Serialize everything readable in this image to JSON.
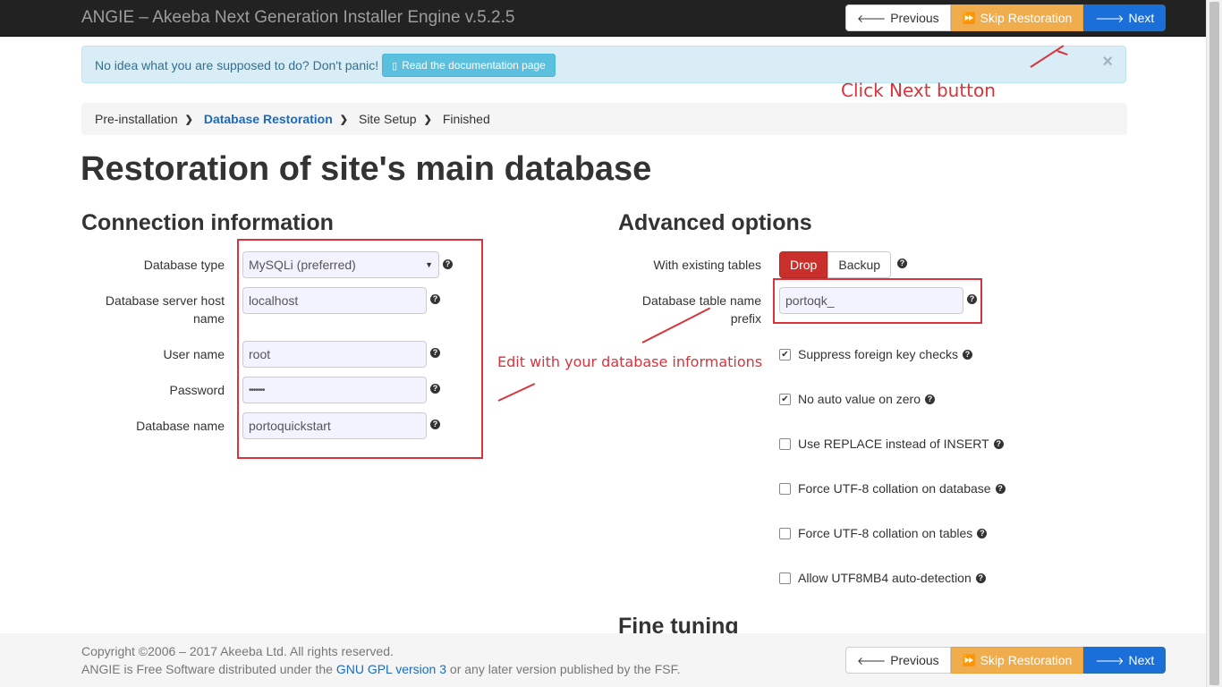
{
  "navbar": {
    "brand": "ANGIE – Akeeba Next Generation Installer Engine v.5.2.5",
    "previous": "Previous",
    "skip": "Skip Restoration",
    "next": "Next"
  },
  "alert": {
    "text": "No idea what you are supposed to do? Don't panic!",
    "doc_button": "Read the documentation page",
    "close": "×"
  },
  "breadcrumb": {
    "items": [
      "Pre-installation",
      "Database Restoration",
      "Site Setup",
      "Finished"
    ]
  },
  "page_title": "Restoration of site's main database",
  "connection": {
    "heading": "Connection information",
    "db_type_label": "Database type",
    "db_type_value": "MySQLi (preferred)",
    "host_label_1": "Database server host",
    "host_label_2": "name",
    "host_value": "localhost",
    "user_label": "User name",
    "user_value": "root",
    "password_label": "Password",
    "password_value": "•••••••",
    "dbname_label": "Database name",
    "dbname_value": "portoquickstart"
  },
  "advanced": {
    "heading": "Advanced options",
    "existing_label": "With existing tables",
    "drop": "Drop",
    "backup": "Backup",
    "prefix_label_1": "Database table name",
    "prefix_label_2": "prefix",
    "prefix_value": "portoqk_",
    "checkboxes": [
      {
        "label": "Suppress foreign key checks",
        "checked": true
      },
      {
        "label": "No auto value on zero",
        "checked": true
      },
      {
        "label": "Use REPLACE instead of INSERT",
        "checked": false
      },
      {
        "label": "Force UTF-8 collation on database",
        "checked": false
      },
      {
        "label": "Force UTF-8 collation on tables",
        "checked": false
      },
      {
        "label": "Allow UTF8MB4 auto-detection",
        "checked": false
      }
    ]
  },
  "fine_tuning_heading": "Fine tuning",
  "annotations": {
    "next_hint": "Click Next button",
    "edit_hint": "Edit with your database informations"
  },
  "footer": {
    "copyright": "Copyright ©2006 – 2017 Akeeba Ltd. All rights reserved.",
    "license_prefix": "ANGIE is Free Software distributed under the ",
    "license_link": "GNU GPL version 3",
    "license_suffix": " or any later version published by the FSF.",
    "previous": "Previous",
    "skip": "Skip Restoration",
    "next": "Next"
  },
  "colors": {
    "navbar": "#222222",
    "annotation_red": "#d9343b",
    "primary": "#1a6fd8",
    "warning": "#f0ad4e",
    "danger": "#c9302c"
  }
}
